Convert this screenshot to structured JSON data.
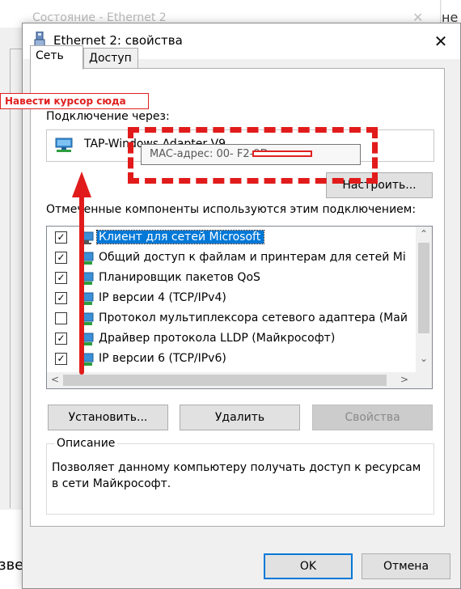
{
  "background": {
    "title": "Состояние - Ethernet 2",
    "close_glyph": "✕",
    "right_text": "не",
    "bottom_text": "зве"
  },
  "dialog": {
    "title": "Ethernet 2: свойства",
    "close_glyph": "✕",
    "tabs": [
      "Сеть",
      "Доступ"
    ],
    "connect_via_label": "Подключение через:",
    "adapter_name": "TAP-Windows Adapter V9",
    "tooltip_text": "MAC-адрес: 00-                  F2-9D",
    "configure_button": "Настроить...",
    "components_label": "Отмеченные компоненты используются этим подключением:",
    "components": [
      {
        "label": "Клиент для сетей Microsoft",
        "checked": true,
        "selected": true,
        "icon": "network-client-icon"
      },
      {
        "label": "Общий доступ к файлам и принтерам для сетей Mi",
        "checked": true,
        "selected": false,
        "icon": "service-icon"
      },
      {
        "label": "Планировщик пакетов QoS",
        "checked": true,
        "selected": false,
        "icon": "service-icon"
      },
      {
        "label": "IP версии 4 (TCP/IPv4)",
        "checked": true,
        "selected": false,
        "icon": "protocol-icon"
      },
      {
        "label": "Протокол мультиплексора сетевого адаптера (Май",
        "checked": false,
        "selected": false,
        "icon": "protocol-icon"
      },
      {
        "label": "Драйвер протокола LLDP (Майкрософт)",
        "checked": true,
        "selected": false,
        "icon": "protocol-icon"
      },
      {
        "label": "IP версии 6 (TCP/IPv6)",
        "checked": true,
        "selected": false,
        "icon": "protocol-icon"
      }
    ],
    "install_button": "Установить...",
    "remove_button": "Удалить",
    "properties_button": "Свойства",
    "description_title": "Описание",
    "description_text": "Позволяет данному компьютеру получать доступ к ресурсам в сети Майкрософт.",
    "ok_button": "OK",
    "cancel_button": "Отмена"
  },
  "annotation": {
    "label": "Навести курсор сюда",
    "color": "#e11b1b"
  },
  "colors": {
    "selection": "#0078d7",
    "dialog_bg": "#f0f0f0",
    "annotation_red": "#e11b1b"
  }
}
